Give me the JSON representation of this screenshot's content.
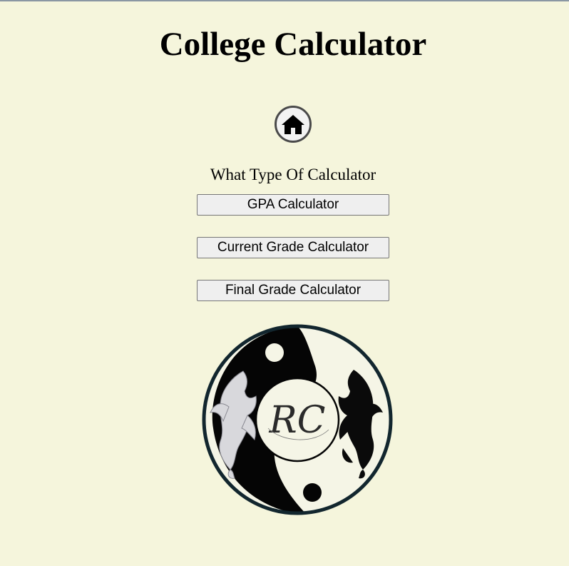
{
  "header": {
    "title": "College Calculator"
  },
  "nav": {
    "home_icon": "home-icon"
  },
  "main": {
    "prompt": "What Type Of Calculator",
    "buttons": {
      "gpa": "GPA Calculator",
      "current": "Current Grade Calculator",
      "final": "Final Grade Calculator"
    }
  },
  "logo": {
    "monogram": "RC"
  },
  "colors": {
    "background": "#f5f5dc",
    "button_bg": "#efefef",
    "button_border": "#767676",
    "logo_ring": "#12262e"
  }
}
